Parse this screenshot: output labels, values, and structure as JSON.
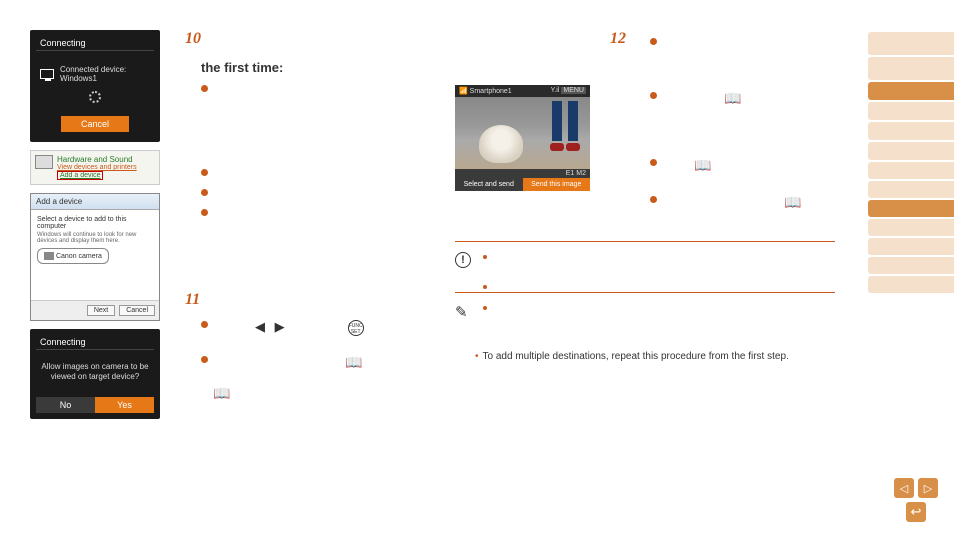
{
  "screens": {
    "connecting1": {
      "title": "Connecting",
      "device_label": "Connected device:",
      "device_name": "Windows1",
      "cancel": "Cancel"
    },
    "hw_sound": {
      "title": "Hardware and Sound",
      "sub1": "View devices and printers",
      "sub2": "Add a device"
    },
    "add_device": {
      "title": "Add a device",
      "prompt": "Select a device to add to this computer",
      "hint": "Windows will continue to look for new devices and display them here.",
      "device": "Canon camera",
      "next": "Next",
      "cancel": "Cancel"
    },
    "connecting2": {
      "title": "Connecting",
      "msg": "Allow images on camera to be viewed on target device?",
      "no": "No",
      "yes": "Yes"
    },
    "send": {
      "top_left": "Smartphone1",
      "top_right_signal": "Y.il",
      "top_right_menu": "MENU",
      "mid": "E1 M2",
      "select_send": "Select and send",
      "send_this": "Send this image"
    }
  },
  "steps": {
    "s10": "10",
    "s10_heading": "the first time:",
    "s11": "11",
    "s12": "12"
  },
  "arrows": {
    "left": "◀",
    "right": "▶"
  },
  "func": "FUNC SET",
  "footnote": "To add multiple destinations, repeat this procedure from the first step.",
  "icons": {
    "book": "📖",
    "excl": "!",
    "pencil": "✎",
    "return": "↩"
  }
}
